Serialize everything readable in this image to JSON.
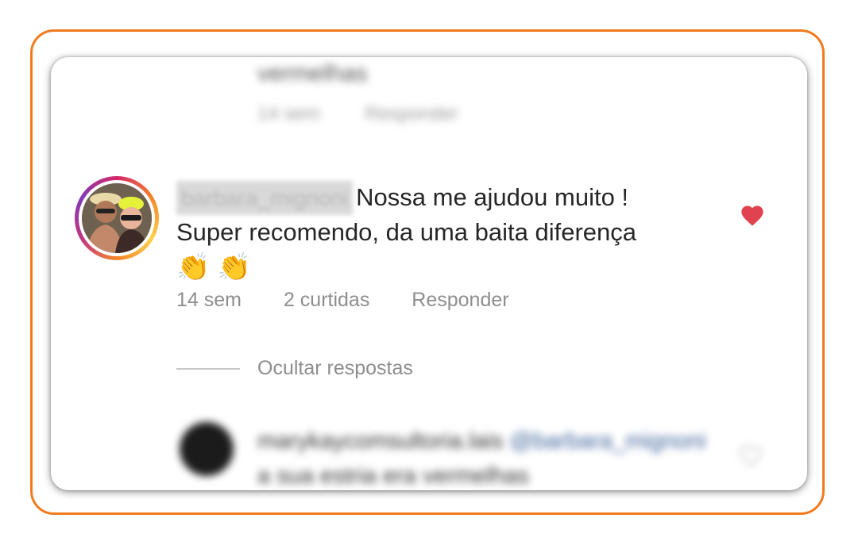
{
  "previous_comment": {
    "text": "vermelhas",
    "time": "14 sem",
    "reply": "Responder"
  },
  "comment": {
    "username": "barbara_mignoni",
    "text_line1": "Nossa me ajudou muito !",
    "text_line2": "Super recomendo, da uma baita diferença",
    "emoji": "👏 👏",
    "liked": true,
    "heart_color": "#e0434f",
    "time": "14 sem",
    "likes": "2 curtidas",
    "reply": "Responder",
    "hide_replies": "Ocultar respostas"
  },
  "reply_comment": {
    "username": "marykaycomsultoria.lais",
    "mention": "@barbara_mignoni",
    "text": "a sua estria era vermelhas"
  },
  "colors": {
    "frame_border": "#f07b1e",
    "meta_text": "#8e8e8e"
  }
}
